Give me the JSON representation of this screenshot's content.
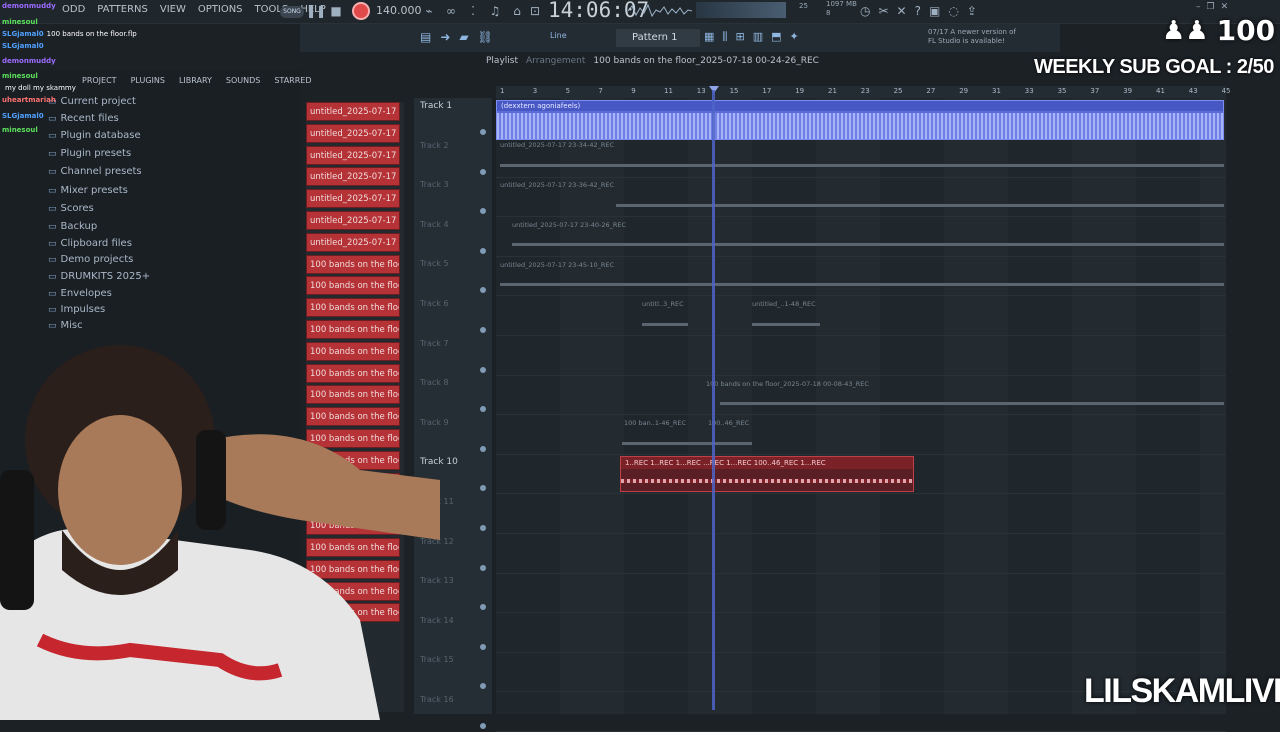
{
  "menus": [
    "ODD",
    "PATTERNS",
    "VIEW",
    "OPTIONS",
    "TOOLS",
    "HELP"
  ],
  "transport": {
    "mode": "SONG",
    "bpm": "140.000",
    "time": "14:06:07"
  },
  "status": {
    "cpu": "25",
    "memory": "1097 MB",
    "poly": "8"
  },
  "pattern": "Pattern 1",
  "snap": "Line",
  "news": {
    "date": "07/17",
    "text": "A newer version of FL Studio is available!"
  },
  "browser": {
    "tabs": [
      "PROJECT",
      "PLUGINS",
      "LIBRARY",
      "SOUNDS",
      "STARRED"
    ],
    "items": [
      "Current project",
      "Recent files",
      "Plugin database",
      "Plugin presets",
      "Channel presets",
      "Mixer presets",
      "Scores",
      "Backup",
      "Clipboard files",
      "Demo projects",
      "DRUMKITS 2025+",
      "Envelopes",
      "Impulses",
      "Misc"
    ]
  },
  "chat": [
    {
      "user": "demonmuddy",
      "text": "",
      "color": "#9b6cff"
    },
    {
      "user": "minesoul",
      "text": "",
      "color": "#5ce05c"
    },
    {
      "user": "SLGjamal0",
      "text": "100 bands on the floor.flp",
      "color": "#4fa0ff"
    },
    {
      "user": "SLGjamal0",
      "text": "",
      "color": "#4fa0ff"
    },
    {
      "user": "demonmuddy",
      "text": "",
      "color": "#9b6cff"
    },
    {
      "user": "minesoul",
      "text": "",
      "color": "#5ce05c"
    },
    {
      "user": "",
      "text": "my doll my skammy",
      "color": "#ff7070"
    },
    {
      "user": "uheartmariah",
      "text": "",
      "color": "#ff7070"
    },
    {
      "user": "SLGjamal0",
      "text": "",
      "color": "#4fa0ff"
    },
    {
      "user": "minesoul",
      "text": "",
      "color": "#5ce05c"
    }
  ],
  "playlist": {
    "title": "Playlist",
    "subtitle": "Arrangement",
    "project": "100 bands on the floor_2025-07-18 00-24-26_REC",
    "ruler": [
      "1",
      "3",
      "5",
      "7",
      "9",
      "11",
      "13",
      "15",
      "17",
      "19",
      "21",
      "23",
      "25",
      "27",
      "29",
      "31",
      "33",
      "35",
      "37",
      "39",
      "41",
      "43",
      "45"
    ],
    "tracks": [
      "Track 1",
      "Track 2",
      "Track 3",
      "Track 4",
      "Track 5",
      "Track 6",
      "Track 7",
      "Track 8",
      "Track 9",
      "Track 10",
      "Track 11",
      "Track 12",
      "Track 13",
      "Track 14",
      "Track 15",
      "Track 16"
    ],
    "clips": {
      "t1": "(dexxtern agoniafeels)",
      "t2": "untitled_2025-07-17 23-34-42_REC",
      "t3": "untitled_2025-07-17 23-36-42_REC",
      "t4": "untitled_2025-07-17 23-40-26_REC",
      "t5": "untitled_2025-07-17 23-45-10_REC",
      "t6a": "untitl..3_REC",
      "t6b": "untitled_..1-48_REC",
      "t8": "100 bands on the floor_2025-07-18 00-08-43_REC",
      "t9a": "100 ban..1-46_REC",
      "t9b": "100..46_REC",
      "t10": "1..REC   1..REC   1...REC   ...REC   1...REC   100..46_REC   1...REC"
    }
  },
  "channels": [
    "untitled_2025-07-17 23...",
    "untitled_2025-07-17 23...",
    "untitled_2025-07-17 23...",
    "untitled_2025-07-17 23...",
    "untitled_2025-07-17 23...",
    "untitled_2025-07-17 23...",
    "untitled_2025-07-17 23...",
    "100 bands on the floor_...",
    "100 bands on the floor_...",
    "100 bands on the floor_...",
    "100 bands on the floor_...",
    "100 bands on the floor_...",
    "100 bands on the floor_...",
    "100 bands on the floor_...",
    "100 bands on the floor_...",
    "100 bands on the floor_...",
    "100 bands on the floor_...",
    "100 bands on the floor_...",
    "100 bands on the floor_...",
    "100 bands on the floor_...",
    "100 bands on the floor_...",
    "100 bands on the floor_...",
    "100 bands on the floor_...",
    "100 bands on the floor_..."
  ],
  "overlay": {
    "sub_count": "100",
    "sub_goal": "WEEKLY SUB GOAL : 2/50",
    "watermark": "LILSKAMLIVE"
  }
}
